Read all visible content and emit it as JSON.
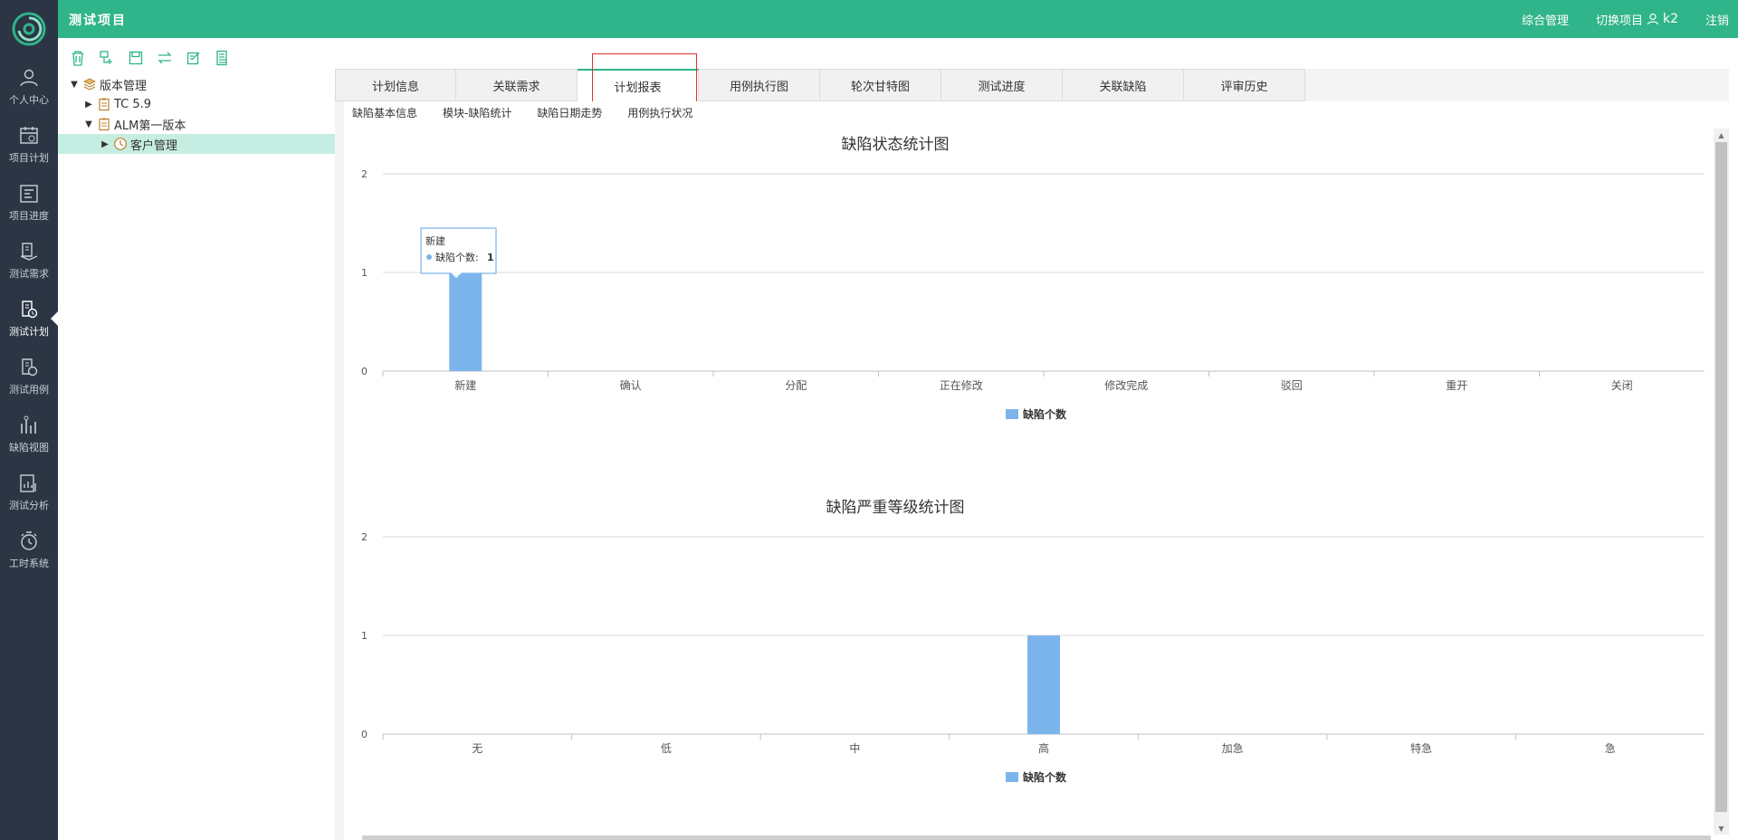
{
  "header": {
    "project_title": "测试项目",
    "overall_mgmt": "综合管理",
    "switch_project": "切换项目",
    "username": "k2",
    "logout": "注销"
  },
  "leftnav": {
    "items": [
      {
        "label": "个人中心",
        "icon": "person-icon"
      },
      {
        "label": "项目计划",
        "icon": "calendar-icon"
      },
      {
        "label": "项目进度",
        "icon": "progress-icon"
      },
      {
        "label": "测试需求",
        "icon": "layers-icon"
      },
      {
        "label": "测试计划",
        "icon": "plan-clock-icon",
        "active": true
      },
      {
        "label": "测试用例",
        "icon": "case-icon"
      },
      {
        "label": "缺陷视图",
        "icon": "bug-chart-icon"
      },
      {
        "label": "测试分析",
        "icon": "analysis-icon"
      },
      {
        "label": "工时系统",
        "icon": "timer-icon"
      }
    ]
  },
  "toolbar": {
    "icons": [
      "delete-icon",
      "add-node-icon",
      "save-icon",
      "swap-icon",
      "edit-icon",
      "list-icon"
    ]
  },
  "tree": {
    "root": "版本管理",
    "node1": "TC 5.9",
    "node2": "ALM第一版本",
    "node2_child": "客户管理"
  },
  "tabs": [
    "计划信息",
    "关联需求",
    "计划报表",
    "用例执行图",
    "轮次甘特图",
    "测试进度",
    "关联缺陷",
    "评审历史"
  ],
  "active_tab": "计划报表",
  "subtabs": [
    "缺陷基本信息",
    "模块-缺陷统计",
    "缺陷日期走势",
    "用例执行状况"
  ],
  "colors": {
    "accent": "#30b48a",
    "bar": "#7cb5ec",
    "nav_bg": "#2b3544",
    "highlight": "#e03030"
  },
  "tooltip": {
    "title": "新建",
    "series": "缺陷个数",
    "value": "1"
  },
  "chart_data": [
    {
      "type": "bar",
      "title": "缺陷状态统计图",
      "categories": [
        "新建",
        "确认",
        "分配",
        "正在修改",
        "修改完成",
        "驳回",
        "重开",
        "关闭"
      ],
      "series": [
        {
          "name": "缺陷个数",
          "values": [
            1,
            0,
            0,
            0,
            0,
            0,
            0,
            0
          ]
        }
      ],
      "ylim": [
        0,
        2
      ],
      "yticks": [
        0,
        1,
        2
      ],
      "grid": true,
      "legend": "bottom-center"
    },
    {
      "type": "bar",
      "title": "缺陷严重等级统计图",
      "categories": [
        "无",
        "低",
        "中",
        "高",
        "加急",
        "特急",
        "急"
      ],
      "series": [
        {
          "name": "缺陷个数",
          "values": [
            0,
            0,
            0,
            1,
            0,
            0,
            0
          ]
        }
      ],
      "ylim": [
        0,
        2
      ],
      "yticks": [
        0,
        1,
        2
      ],
      "grid": true,
      "legend": "bottom-center"
    }
  ]
}
